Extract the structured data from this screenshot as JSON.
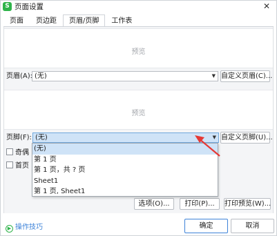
{
  "window": {
    "title": "页面设置",
    "app_icon_letter": "S",
    "close_glyph": "✕"
  },
  "tabs": [
    {
      "label": "页面",
      "active": false
    },
    {
      "label": "页边距",
      "active": false
    },
    {
      "label": "页眉/页脚",
      "active": true
    },
    {
      "label": "工作表",
      "active": false
    }
  ],
  "header": {
    "preview_label": "预览",
    "label": "页眉(A):",
    "value": "(无)",
    "custom_button": "自定义页眉(C)..."
  },
  "footer": {
    "preview_label": "预览",
    "label": "页脚(F):",
    "value": "(无)",
    "custom_button": "自定义页脚(U)..."
  },
  "checkboxes": [
    {
      "label": "奇偶页不同",
      "visible_label": "奇偶",
      "checked": false
    },
    {
      "label": "首页不同",
      "visible_label": "首页",
      "checked": false
    }
  ],
  "dropdown": {
    "items": [
      "(无)",
      "第 1 页",
      "第 1 页，共 ? 页",
      "Sheet1",
      "第 1 页, Sheet1"
    ],
    "selected_index": 0
  },
  "buttons": {
    "options": "选项(O)...",
    "print": "打印(P)...",
    "print_preview": "打印预览(W)..."
  },
  "bottom": {
    "tips": "操作技巧",
    "ok": "确定",
    "cancel": "取消"
  },
  "colors": {
    "accent": "#3c82d8",
    "app_icon": "#2fb34a",
    "selection": "#cfe3f7",
    "annotation_arrow": "#e53935"
  },
  "icons": {
    "app": "wps-spreadsheet-icon",
    "close": "close-icon",
    "dropdown_arrow": "chevron-down-icon",
    "tips": "play-circle-icon"
  }
}
